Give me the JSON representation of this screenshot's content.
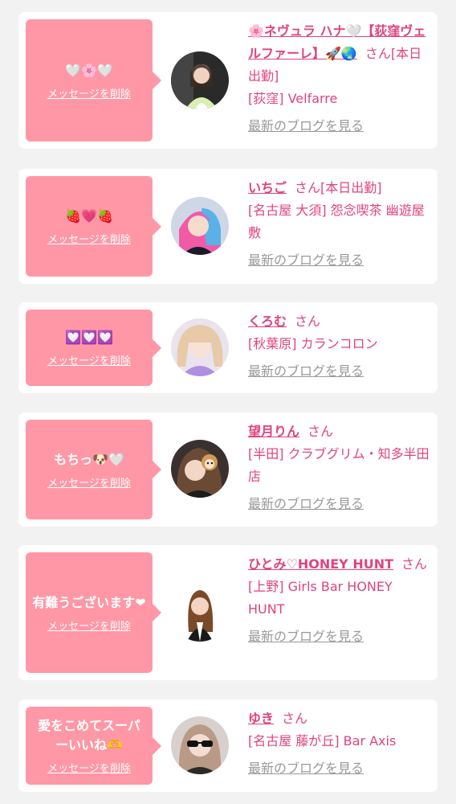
{
  "delete_label": "メッセージを削除",
  "san_suffix": "さん",
  "blog_link": "最新のブログを見る",
  "colors": {
    "bubble": "#ff97a6",
    "accent": "#e0437f",
    "muted": "#999999",
    "card": "#ffffff",
    "background": "#f2f2f2"
  },
  "items": [
    {
      "message": "🤍🌸🤍",
      "name": "🌸ネヴュラ ハナ🤍【荻窪ヴェルファーレ】🚀🌏",
      "suffix_extra": "[本日出勤]",
      "shop": "[荻窪] Velfarre"
    },
    {
      "message": "🍓💗🍓",
      "name": "いちご",
      "suffix_extra": "[本日出勤]",
      "shop": "[名古屋 大須] 怨念喫茶 幽遊屋敷"
    },
    {
      "message": "💟💟💟",
      "name": "くろむ",
      "suffix_extra": "",
      "shop": "[秋葉原] カランコロン"
    },
    {
      "message": "もちっ🐶🤍",
      "name": "望月りん",
      "suffix_extra": "",
      "shop": "[半田] クラブグリム・知多半田店"
    },
    {
      "message": "有難うございます❤",
      "name": "ひとみ♡HONEY HUNT",
      "suffix_extra": "",
      "shop": "[上野] Girls Bar HONEY HUNT"
    },
    {
      "message": "愛をこめてスーパーいいね🫶",
      "name": "ゆき",
      "suffix_extra": "",
      "shop": "[名古屋 藤が丘] Bar Axis"
    }
  ]
}
